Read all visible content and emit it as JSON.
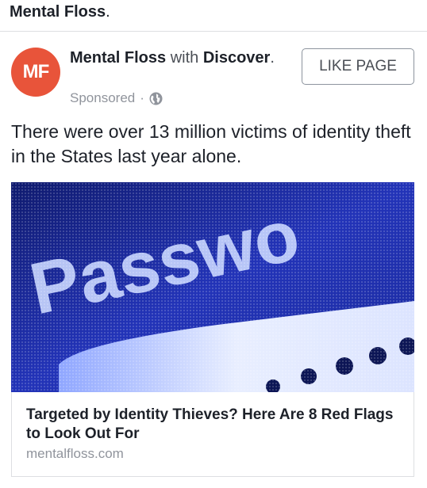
{
  "top_strip": {
    "page_name": "Mental Floss",
    "trailing": "."
  },
  "post": {
    "avatar_initials": "MF",
    "avatar_color": "#e8543a",
    "author": "Mental Floss",
    "with_word": "with",
    "partner": "Discover",
    "partner_trailing": ".",
    "sponsored_label": "Sponsored",
    "separator": "·",
    "audience_icon": "globe-icon",
    "like_button_label": "LIKE PAGE",
    "message": "There were over 13 million victims of identity theft in the States last year alone.",
    "link_card": {
      "image_text": "Passwo",
      "image_colors": {
        "background": "#1a2a9c",
        "text": "#c8d6ff"
      },
      "title": "Targeted by Identity Thieves? Here Are 8 Red Flags to Look Out For",
      "domain": "mentalfloss.com"
    }
  }
}
